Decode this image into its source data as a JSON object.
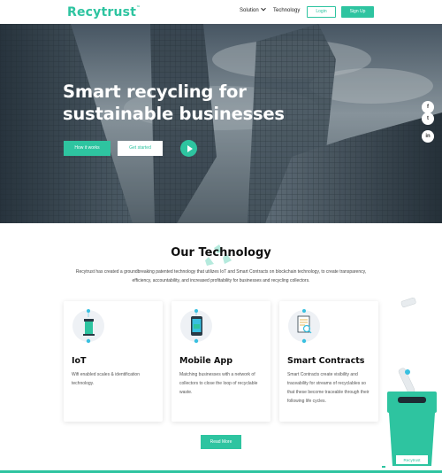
{
  "nav": {
    "logo": "Recytrust",
    "logo_mark": "™",
    "solution_label": "Solution",
    "technology_label": "Technology",
    "login_label": "Login",
    "signup_label": "Sign Up"
  },
  "hero": {
    "title": "Smart recycling for sustainable businesses",
    "primary_button": "How it works",
    "secondary_button": "Get started",
    "social": {
      "facebook": "f",
      "twitter": "t",
      "linkedin": "in"
    }
  },
  "technology": {
    "title": "Our Technology",
    "description": "Recytrust has created a groundbreaking patented technology that utilizes IoT and Smart Contracts on blockchain technology, to create transparency, efficiency, accountability, and increased profitability for businesses and recycling collectors.",
    "cards": [
      {
        "title": "IoT",
        "text": "Wifi enabled scales & identification technology.",
        "icon": "smart-bin-icon"
      },
      {
        "title": "Mobile App",
        "text": "Matching businesses with a network of collectors to close the loop of recyclable waste.",
        "icon": "smartphone-icon"
      },
      {
        "title": "Smart Contracts",
        "text": "Smart Contracts create visibility and traceability for streams of recyclables so that these become traceable through their following life cycles.",
        "icon": "contract-icon"
      }
    ],
    "read_more": "Read More",
    "bin_label": "Recytrust"
  },
  "colors": {
    "accent": "#2ec4a0"
  }
}
